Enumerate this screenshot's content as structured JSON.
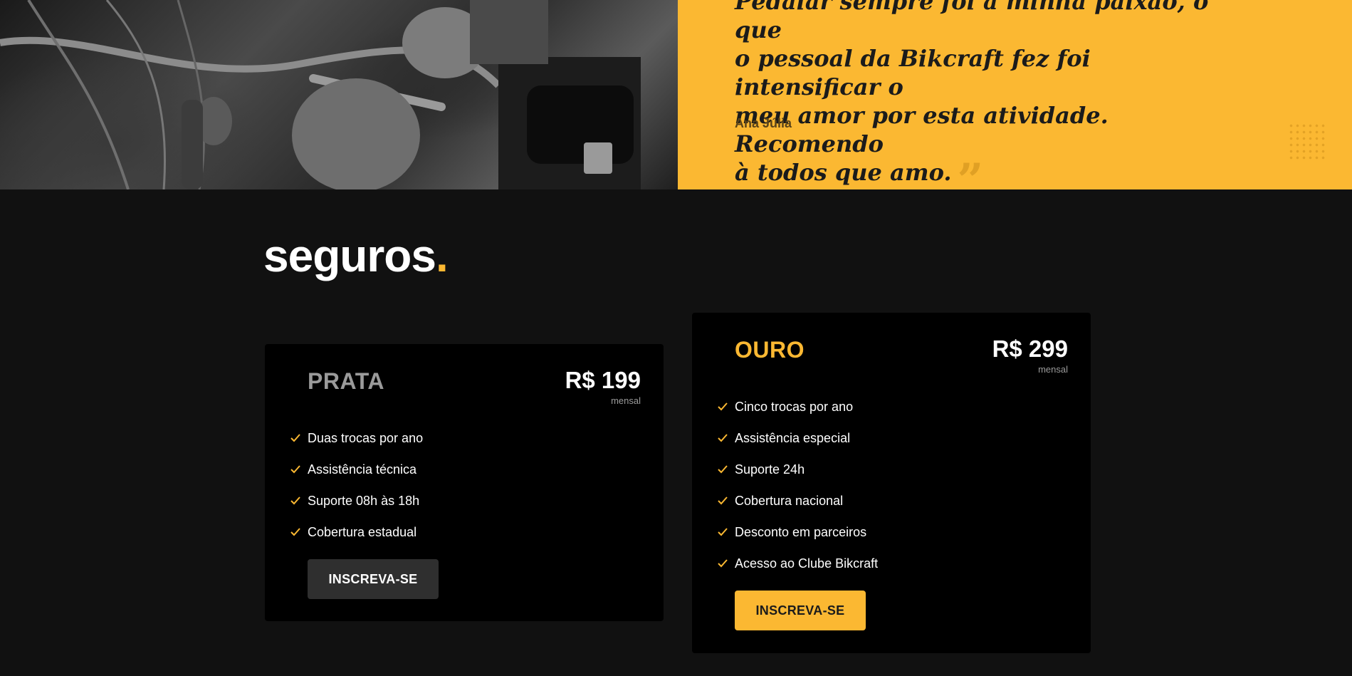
{
  "testimonial": {
    "quote_lines": [
      "Pedalar sempre foi a minha paixão, o que",
      "o pessoal da Bikcraft fez foi intensificar o",
      "meu amor por esta atividade. Recomendo",
      "à todos que amo."
    ],
    "quote_close_mark": "”",
    "author": "Ana Júlia"
  },
  "seguros": {
    "title": "seguros",
    "title_dot": ".",
    "plans": [
      {
        "name": "PRATA",
        "price": "R$ 199",
        "price_note": "mensal",
        "features": [
          "Duas trocas por ano",
          "Assistência técnica",
          "Suporte 08h às 18h",
          "Cobertura estadual"
        ],
        "button_label": "INSCREVA-SE"
      },
      {
        "name": "OURO",
        "price": "R$ 299",
        "price_note": "mensal",
        "features": [
          "Cinco trocas por ano",
          "Assistência especial",
          "Suporte 24h",
          "Cobertura nacional",
          "Desconto em parceiros",
          "Acesso ao Clube Bikcraft"
        ],
        "button_label": "INSCREVA-SE"
      }
    ]
  },
  "colors": {
    "accent": "#fbb832",
    "background": "#111111",
    "card": "#000000",
    "silver": "#9a9a9a"
  },
  "icons": {
    "feature": "check-icon",
    "quote": "quote-close-icon",
    "decor": "dot-grid-icon"
  }
}
